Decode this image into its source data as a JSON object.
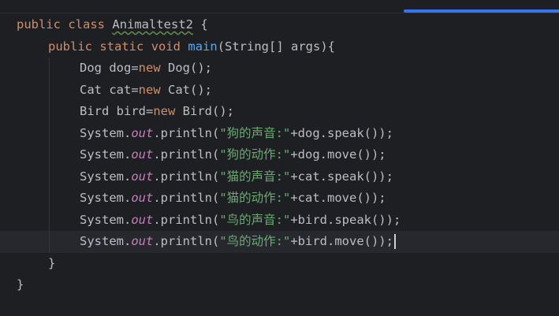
{
  "code": {
    "class_decl": {
      "kw_public": "public",
      "kw_class": "class",
      "class_name": "Animaltest2",
      "brace_open": " {"
    },
    "main_decl": {
      "kw_public": "public",
      "kw_static": "static",
      "kw_void": "void",
      "method_name": "main",
      "params": "(String[] args){"
    },
    "dog_decl": {
      "type": "Dog dog=",
      "kw_new": "new",
      "rest": " Dog();"
    },
    "cat_decl": {
      "type": "Cat cat=",
      "kw_new": "new",
      "rest": " Cat();"
    },
    "bird_decl": {
      "type": "Bird bird=",
      "kw_new": "new",
      "rest": " Bird();"
    },
    "prints": [
      {
        "prefix": "System.",
        "out": "out",
        "call": ".println(",
        "str": "\"狗的声音:\"",
        "suffix": "+dog.speak());"
      },
      {
        "prefix": "System.",
        "out": "out",
        "call": ".println(",
        "str": "\"狗的动作:\"",
        "suffix": "+dog.move());"
      },
      {
        "prefix": "System.",
        "out": "out",
        "call": ".println(",
        "str": "\"猫的声音:\"",
        "suffix": "+cat.speak());"
      },
      {
        "prefix": "System.",
        "out": "out",
        "call": ".println(",
        "str": "\"猫的动作:\"",
        "suffix": "+cat.move());"
      },
      {
        "prefix": "System.",
        "out": "out",
        "call": ".println(",
        "str": "\"鸟的声音:\"",
        "suffix": "+bird.speak());"
      },
      {
        "prefix": "System.",
        "out": "out",
        "call": ".println(",
        "str": "\"鸟的动作:\"",
        "suffix": "+bird.move());"
      }
    ],
    "main_close": "}",
    "class_close": "}"
  },
  "colors": {
    "background": "#1e1f22",
    "keyword": "#cf8e6d",
    "method": "#56a8f5",
    "static_field": "#c77dbb",
    "string": "#6aab73",
    "text": "#bcbec4",
    "accent": "#3574f0"
  }
}
